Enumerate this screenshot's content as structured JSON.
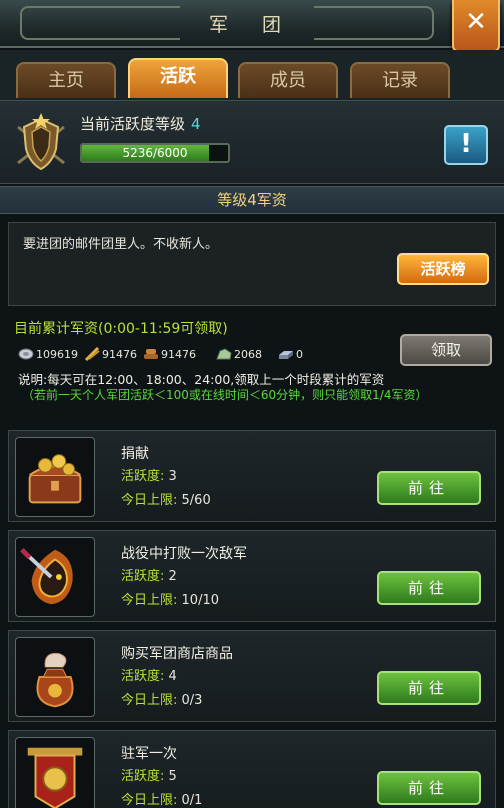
{
  "window": {
    "title": "军 团"
  },
  "tabs": [
    {
      "label": "主页",
      "active": false
    },
    {
      "label": "活跃",
      "active": true
    },
    {
      "label": "成员",
      "active": false
    },
    {
      "label": "记录",
      "active": false
    }
  ],
  "level": {
    "label": "当前活跃度等级",
    "value": "4",
    "progress_text": "5236/6000",
    "progress_current": 5236,
    "progress_max": 6000,
    "info_icon": "!"
  },
  "section": {
    "header": "等级4军资"
  },
  "notice": {
    "text": "要进团的邮件团里人。不收新人。",
    "rank_button": "活跃榜"
  },
  "accumulated": {
    "title": "目前累计军资(0:00-11:59可领取)",
    "resources": [
      {
        "icon": "silver-icon",
        "value": "109619"
      },
      {
        "icon": "grain-icon",
        "value": "91476"
      },
      {
        "icon": "wood-icon",
        "value": "91476"
      },
      {
        "icon": "stone-icon",
        "value": "2068"
      },
      {
        "icon": "iron-icon",
        "value": "0"
      }
    ],
    "claim_button": "领取",
    "explain": "说明:每天可在12:00、18:00、24:00,领取上一个时段累计的军资",
    "note": "（若前一天个人军团活跃＜100或在线时间＜60分钟，则只能领取1/4军资）"
  },
  "tasks": [
    {
      "name": "捐献",
      "activity_label": "活跃度:",
      "activity": "3",
      "limit_label": "今日上限:",
      "limit": "5/60",
      "button": "前往",
      "icon": "treasure-chest-icon"
    },
    {
      "name": "战役中打败一次敌军",
      "activity_label": "活跃度:",
      "activity": "2",
      "limit_label": "今日上限:",
      "limit": "10/10",
      "button": "前往",
      "icon": "sword-beast-icon"
    },
    {
      "name": "购买军团商店商品",
      "activity_label": "活跃度:",
      "activity": "4",
      "limit_label": "今日上限:",
      "limit": "0/3",
      "button": "前往",
      "icon": "money-bag-icon"
    },
    {
      "name": "驻军一次",
      "activity_label": "活跃度:",
      "activity": "5",
      "limit_label": "今日上限:",
      "limit": "0/1",
      "button": "前往",
      "icon": "banner-icon"
    }
  ],
  "colors": {
    "accent_orange": "#e08a2a",
    "green_button": "#4ea02e",
    "label_green": "#b8e23a",
    "cyan_level": "#56d8e0"
  }
}
